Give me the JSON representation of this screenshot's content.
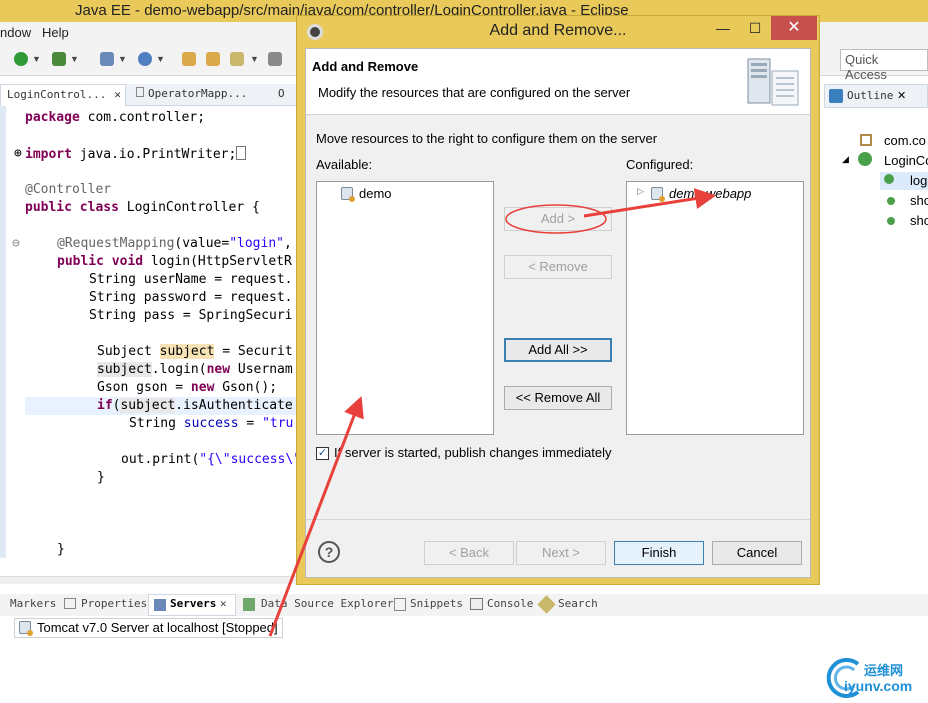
{
  "window": {
    "title": "Java EE - demo-webapp/src/main/java/com/controller/LoginController.java - Eclipse"
  },
  "menu": {
    "items": [
      "ndow",
      "Help"
    ]
  },
  "quick_access": {
    "placeholder": "Quick Access"
  },
  "editor_tabs": [
    "LoginControl...",
    "OperatorMapp...",
    "O"
  ],
  "code": {
    "l1_kw": "package",
    "l1_rest": " com.controller;",
    "l2_kw": "import",
    "l2_rest": " java.io.PrintWriter;",
    "l3": "@Controller",
    "l4_kw1": "public",
    "l4_kw2": "class",
    "l4_rest": " LoginController {",
    "l5_ann": "@RequestMapping",
    "l5_rest": "(value=",
    "l5_str": "\"login\"",
    "l5_end": ",",
    "l6_kw1": "public",
    "l6_kw2": "void",
    "l6_rest": " login(HttpServletR",
    "l7": "String userName = request.",
    "l8": "String password = request.",
    "l9": "String pass = SpringSecuri",
    "l10_a": "Subject ",
    "l10_b": "subject",
    "l10_c": " = Securit",
    "l11_a": "subject",
    "l11_b": ".login(",
    "l11_kw": "new",
    "l11_c": " Usernam",
    "l12_a": "Gson gson = ",
    "l12_kw": "new",
    "l12_b": " Gson();",
    "l13_kw": "if",
    "l13_a": "(",
    "l13_b": "subject",
    "l13_c": ".isAuthenticate",
    "l14_a": "String ",
    "l14_b": "success",
    "l14_c": " = ",
    "l14_str": "\"tru",
    "l15_a": "out.print(",
    "l15_str": "\"{\\\"success\\\"",
    "l16": "}",
    "l17": "}"
  },
  "outline": {
    "tab": "Outline",
    "items": [
      "com.co",
      "LoginCo",
      "log",
      "sho",
      "sho"
    ]
  },
  "bottom_tabs": [
    "Markers",
    "Properties",
    "Servers",
    "Data Source Explorer",
    "Snippets",
    "Console",
    "Search"
  ],
  "server_row": "Tomcat v7.0 Server at localhost  [Stopped]",
  "dialog": {
    "title": "Add and Remove...",
    "header_title": "Add and Remove",
    "header_message": "Modify the resources that are configured on the server",
    "move_message": "Move resources to the right to configure them on the server",
    "available_label": "Available:",
    "configured_label": "Configured:",
    "available_items": [
      "demo"
    ],
    "configured_items": [
      "demo-webapp"
    ],
    "buttons": {
      "add": "Add >",
      "remove": "< Remove",
      "add_all": "Add All >>",
      "remove_all": "<< Remove All",
      "back": "< Back",
      "next": "Next >",
      "finish": "Finish",
      "cancel": "Cancel"
    },
    "publish_label": "If server is started, publish changes immediately",
    "publish_checked": true
  },
  "watermark": {
    "line1": "运维网",
    "line2": "iyunv.com"
  },
  "colors": {
    "titlebar": "#e8c95a",
    "annotation": "#e8403a",
    "keyword": "#7f0055",
    "string": "#2a00ff"
  }
}
